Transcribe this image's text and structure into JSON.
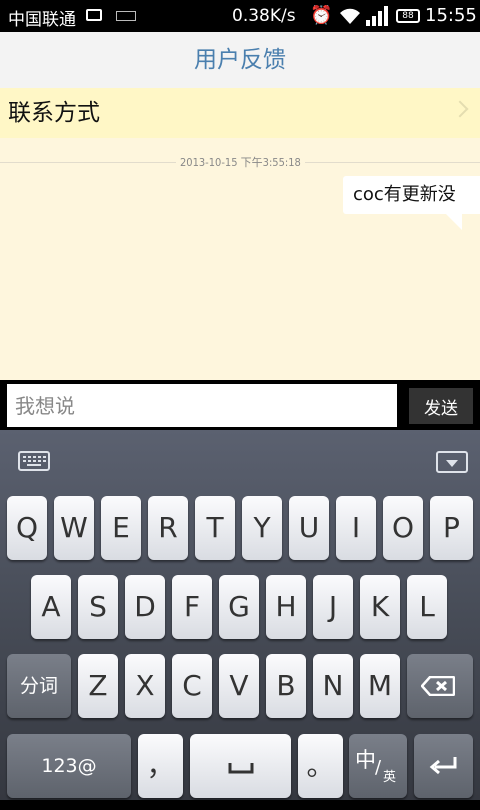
{
  "status_bar": {
    "carrier": "中国联通",
    "net_speed": "0.38K/s",
    "battery": "88",
    "time": "15:55"
  },
  "header": {
    "title": "用户反馈"
  },
  "contact": {
    "label": "联系方式"
  },
  "chat": {
    "timestamp": "2013-10-15 下午3:55:18",
    "messages": [
      {
        "text": "coc有更新没"
      }
    ]
  },
  "composer": {
    "placeholder": "我想说",
    "value": "",
    "send_label": "发送"
  },
  "keyboard": {
    "row1": [
      "Q",
      "W",
      "E",
      "R",
      "T",
      "Y",
      "U",
      "I",
      "O",
      "P"
    ],
    "row2": [
      "A",
      "S",
      "D",
      "F",
      "G",
      "H",
      "J",
      "K",
      "L"
    ],
    "row3_left": "分词",
    "row3": [
      "Z",
      "X",
      "C",
      "V",
      "B",
      "N",
      "M"
    ],
    "bottom": {
      "numbers": "123@",
      "comma": "，",
      "period": "。",
      "lang": "中",
      "lang_sub": "英"
    }
  }
}
